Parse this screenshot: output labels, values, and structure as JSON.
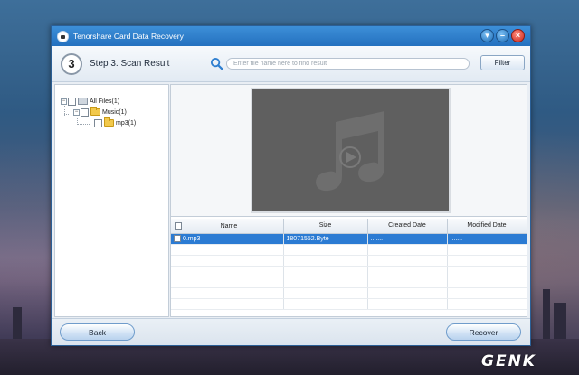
{
  "window": {
    "title": "Tenorshare Card Data Recovery"
  },
  "step": {
    "number": "3",
    "label": "Step 3. Scan Result"
  },
  "search": {
    "placeholder": "Enter file name here to find result"
  },
  "toolbar": {
    "filter_label": "Filter"
  },
  "tree": {
    "items": [
      {
        "label": "All Files(1)",
        "toggle": "−"
      },
      {
        "label": "Music(1)",
        "toggle": "−"
      },
      {
        "label": "mp3(1)"
      }
    ]
  },
  "table": {
    "columns": [
      "Name",
      "Size",
      "Created Date",
      "Modified Date"
    ],
    "rows": [
      {
        "name": "0.mp3",
        "size": "18071552.Byte",
        "created": ".......",
        "modified": "......."
      }
    ]
  },
  "footer": {
    "back_label": "Back",
    "recover_label": "Recover"
  },
  "watermark": "GENK",
  "colors": {
    "titlebar": "#2471bf",
    "selection": "#2b7bd3",
    "preview_bg": "#5f5f5f"
  }
}
